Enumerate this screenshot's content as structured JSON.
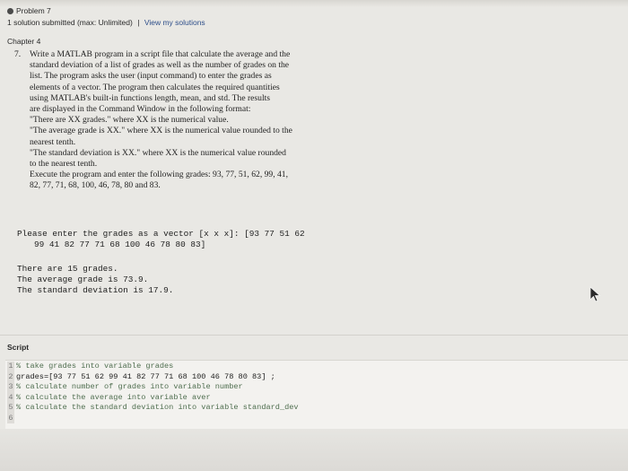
{
  "header": {
    "problem_title": "Problem 7",
    "submissions": "1 solution submitted (max: Unlimited)",
    "separator": "|",
    "view_link": "View my solutions"
  },
  "chapter": "Chapter 4",
  "problem": {
    "number": "7.",
    "lines": [
      "Write a MATLAB program in a script file that calculate the average and the",
      "standard deviation of a list of grades as well as the number of grades on the",
      "list. The program asks the user (input command) to enter the grades as",
      "elements of a vector. The program then calculates the required quantities",
      "using MATLAB's built-in functions length, mean, and std. The results",
      "are displayed in the Command Window in the following format:",
      "\"There are XX grades.\" where XX is the numerical value.",
      "\"The average grade is XX.\" where XX is the numerical value rounded to the",
      "nearest tenth.",
      "\"The standard deviation is XX.\" where XX is the numerical value rounded",
      "to the nearest tenth.",
      "Execute the program and enter the following grades: 93, 77, 51, 62, 99, 41,",
      "82, 77, 71, 68, 100, 46, 78, 80 and 83."
    ]
  },
  "console": {
    "prompt_line1": "Please enter the grades as a vector [x x x]: [93 77 51 62",
    "prompt_line2": "99 41 82 77 71 68 100 46 78 80 83]",
    "output": [
      "There are 15 grades.",
      "The average grade is 73.9.",
      "The standard deviation is 17.9."
    ]
  },
  "script": {
    "label": "Script",
    "lines": [
      {
        "n": "1",
        "text": "% take grades into variable grades",
        "type": "comment"
      },
      {
        "n": "2",
        "text": "grades=[93 77 51 62 99 41 82 77 71 68 100 46 78 80 83] ;",
        "type": "code"
      },
      {
        "n": "3",
        "text": "% calculate number of grades into variable number",
        "type": "comment"
      },
      {
        "n": "4",
        "text": "% calculate the average into variable aver",
        "type": "comment"
      },
      {
        "n": "5",
        "text": "% calculate the standard deviation into variable standard_dev",
        "type": "comment"
      },
      {
        "n": "6",
        "text": "",
        "type": "code"
      }
    ]
  }
}
